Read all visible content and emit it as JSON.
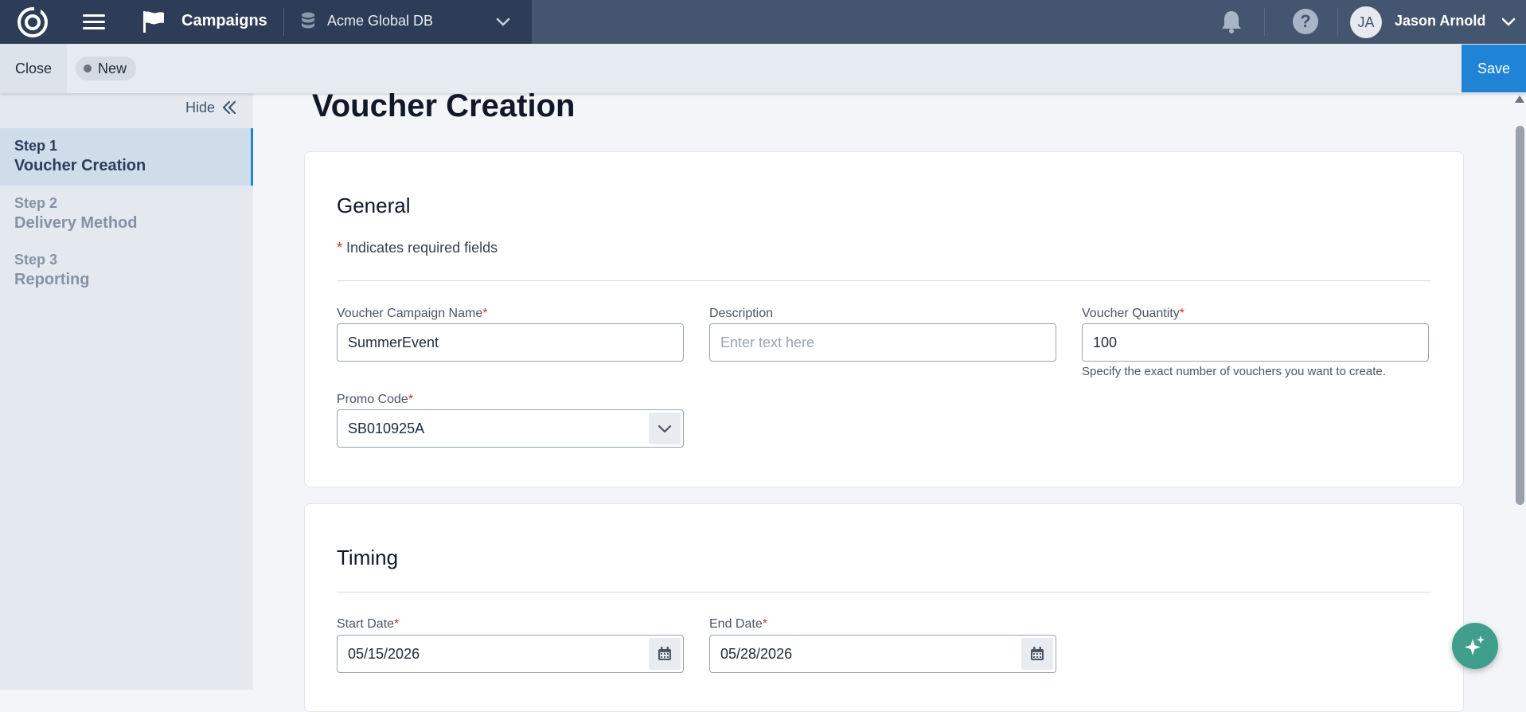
{
  "header": {
    "app_title": "Campaigns",
    "database": "Acme Global DB",
    "user": {
      "initials": "JA",
      "name": "Jason Arnold"
    },
    "help_label": "?"
  },
  "actionbar": {
    "close_label": "Close",
    "status_badge": "New",
    "save_label": "Save"
  },
  "sidebar": {
    "hide_label": "Hide",
    "steps": [
      {
        "number": "Step 1",
        "title": "Voucher Creation",
        "active": true
      },
      {
        "number": "Step 2",
        "title": "Delivery Method",
        "active": false
      },
      {
        "number": "Step 3",
        "title": "Reporting",
        "active": false
      }
    ]
  },
  "main": {
    "page_title": "Voucher Creation",
    "general": {
      "heading": "General",
      "required_star": "*",
      "required_note": "Indicates required fields",
      "campaign_name": {
        "label": "Voucher Campaign Name",
        "value": "SummerEvent"
      },
      "description": {
        "label": "Description",
        "placeholder": "Enter text here"
      },
      "quantity": {
        "label": "Voucher Quantity",
        "value": "100",
        "hint": "Specify the exact number of vouchers you want to create."
      },
      "promo_code": {
        "label": "Promo Code",
        "value": "SB010925A"
      }
    },
    "timing": {
      "heading": "Timing",
      "start_date": {
        "label": "Start Date",
        "value": "05/15/2026"
      },
      "end_date": {
        "label": "End Date",
        "value": "05/28/2026"
      }
    }
  },
  "colors": {
    "topbar": "#44556f",
    "topbar_left": "#2d3d58",
    "accent": "#1f84d6",
    "required": "#d92d20",
    "fab": "#3f9f8c"
  }
}
